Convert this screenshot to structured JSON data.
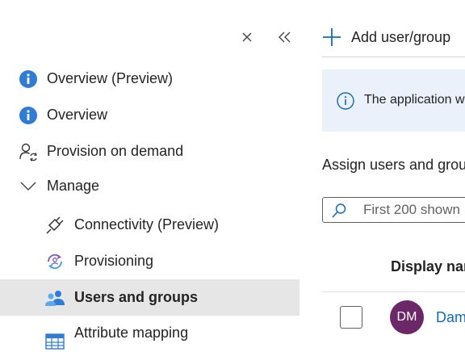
{
  "sidebar": {
    "items": [
      {
        "label": "Overview (Preview)",
        "icon": "info-icon"
      },
      {
        "label": "Overview",
        "icon": "info-icon"
      },
      {
        "label": "Provision on demand",
        "icon": "person-sync-icon"
      },
      {
        "label": "Manage",
        "icon": "chevron-down-icon"
      },
      {
        "label": "Connectivity (Preview)",
        "icon": "plug-icon"
      },
      {
        "label": "Provisioning",
        "icon": "provisioning-icon"
      },
      {
        "label": "Users and groups",
        "icon": "people-icon",
        "selected": true
      },
      {
        "label": "Attribute mapping",
        "icon": "table-icon"
      }
    ]
  },
  "main": {
    "add_button_label": "Add user/group",
    "banner_text": "The application w",
    "assign_text": "Assign users and grou",
    "search": {
      "placeholder": "First 200 shown"
    },
    "table": {
      "column_header": "Display nar",
      "rows": [
        {
          "initials": "DM",
          "name": "Dam"
        }
      ]
    }
  },
  "colors": {
    "accent": "#0f6cbd",
    "info_icon": "#2f7cd6",
    "selected_bg": "#e6e6e6",
    "banner_bg": "#eaf1fb",
    "avatar_bg": "#6b2768"
  }
}
